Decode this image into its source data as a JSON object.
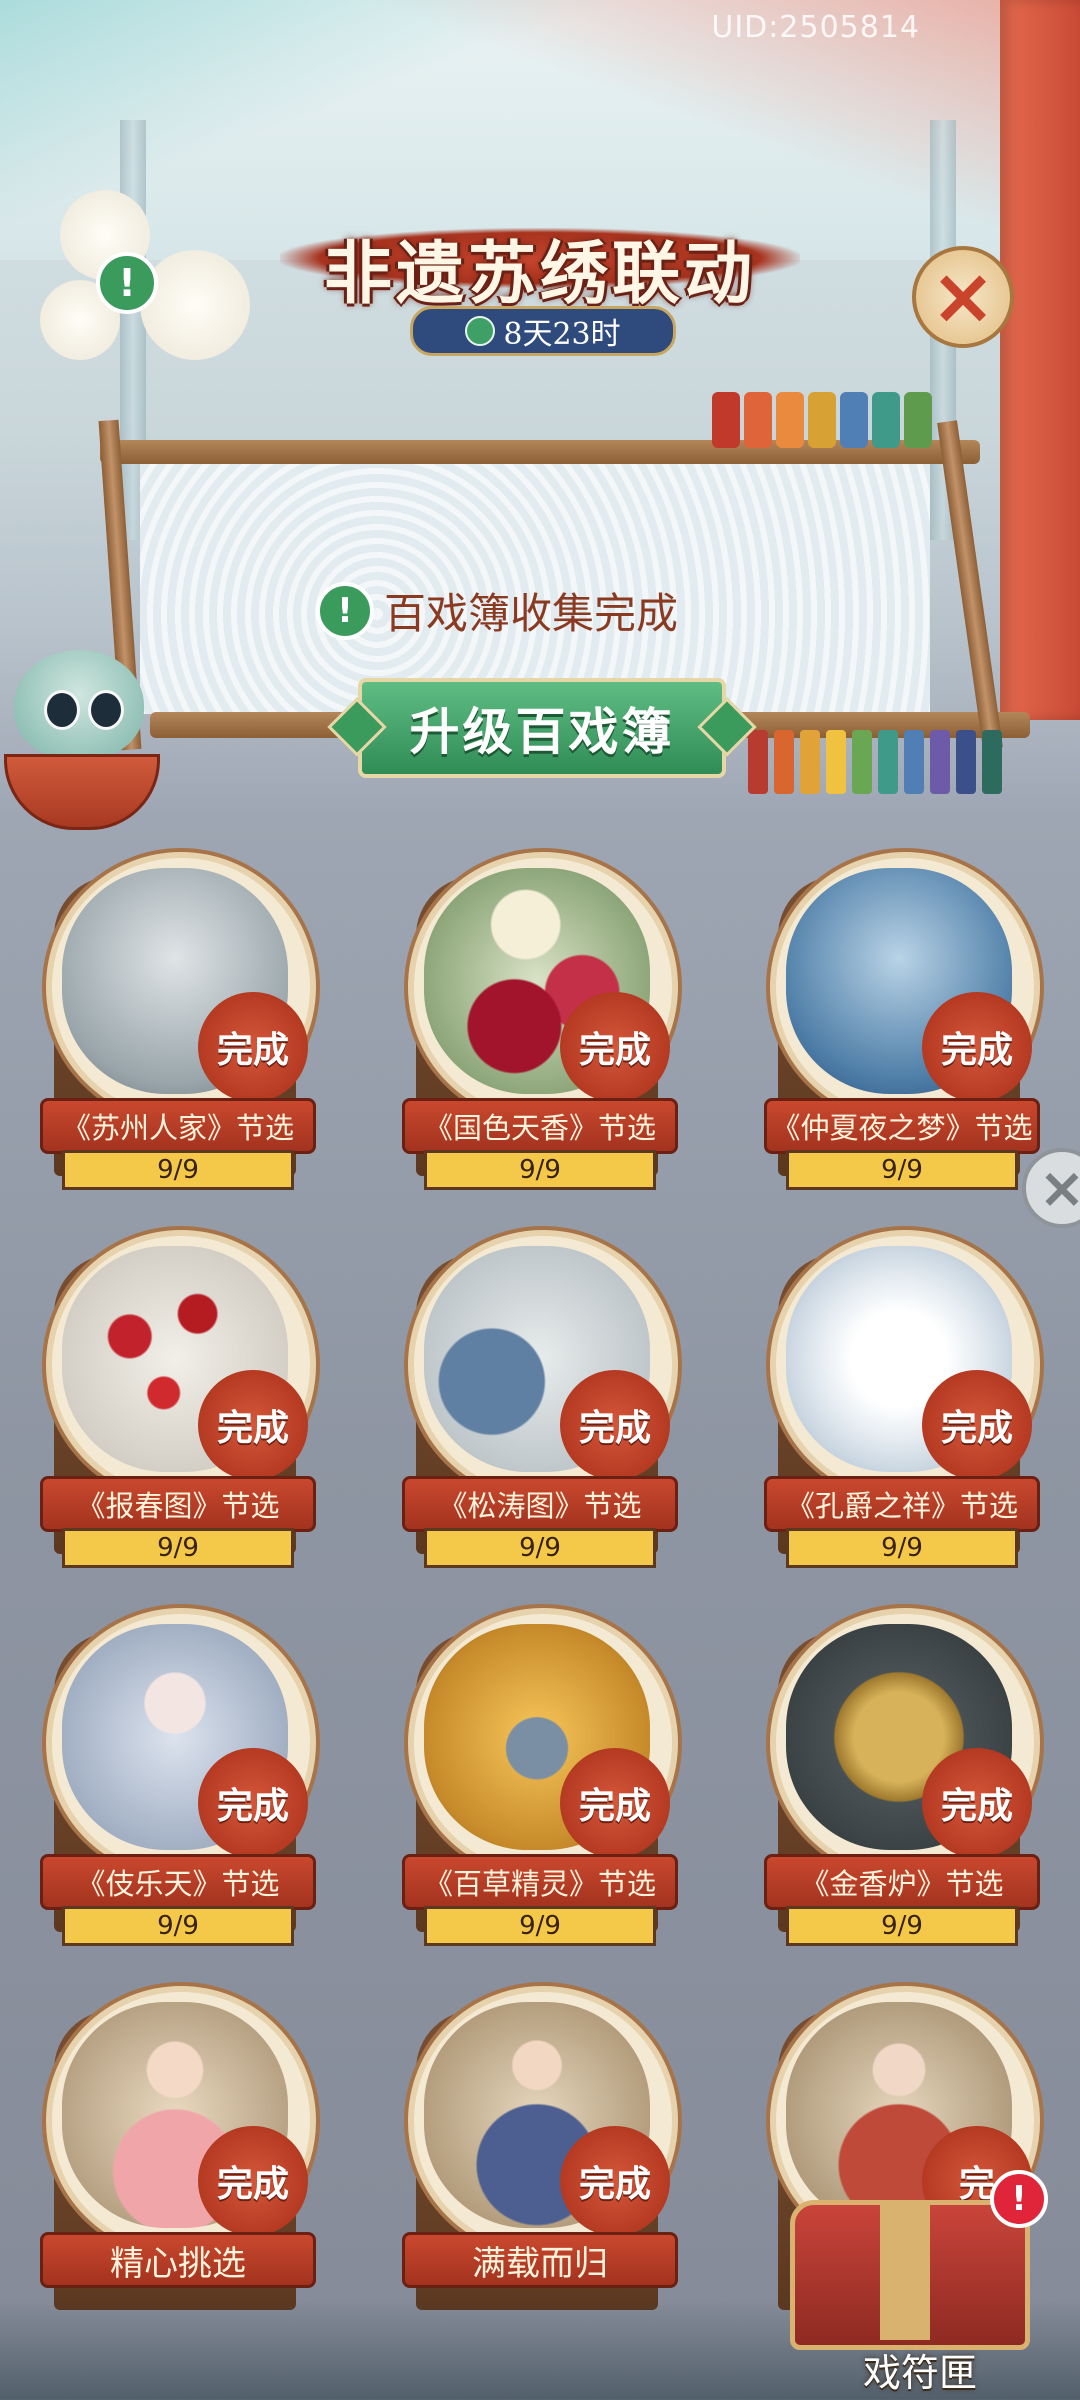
{
  "uid": "UID:2505814",
  "event": {
    "title": "非遗苏绣联动",
    "timer": "8天23时"
  },
  "status": {
    "collection_complete": "百戏簿收集完成",
    "upgrade_button": "升级百戏簿"
  },
  "cards": [
    {
      "label": "《苏州人家》节选",
      "progress": "9/9",
      "badge": "完成",
      "icon": "ink-village-art"
    },
    {
      "label": "《国色天香》节选",
      "progress": "9/9",
      "badge": "完成",
      "icon": "peony-art"
    },
    {
      "label": "《仲夏夜之梦》节选",
      "progress": "9/9",
      "badge": "完成",
      "icon": "lotus-night-art"
    },
    {
      "label": "《报春图》节选",
      "progress": "9/9",
      "badge": "完成",
      "icon": "plum-blossom-art"
    },
    {
      "label": "《松涛图》节选",
      "progress": "9/9",
      "badge": "完成",
      "icon": "pine-crane-art"
    },
    {
      "label": "《孔爵之祥》节选",
      "progress": "9/9",
      "badge": "完成",
      "icon": "white-peacock-art"
    },
    {
      "label": "《伎乐天》节选",
      "progress": "9/9",
      "badge": "完成",
      "icon": "celestial-musician-art"
    },
    {
      "label": "《百草精灵》节选",
      "progress": "9/9",
      "badge": "完成",
      "icon": "golden-monkey-art"
    },
    {
      "label": "《金香炉》节选",
      "progress": "9/9",
      "badge": "完成",
      "icon": "golden-censer-art"
    },
    {
      "label": "精心挑选",
      "badge": "完成",
      "icon": "lady-portrait-art"
    },
    {
      "label": "满载而归",
      "badge": "完成",
      "icon": "scholar-portrait-art"
    },
    {
      "badge": "完",
      "icon": "noble-lady-portrait-art"
    }
  ],
  "chest": {
    "label": "戏符匣",
    "badge": "!"
  },
  "icons": {
    "close": "×",
    "info": "!"
  },
  "colors": {
    "accent_red": "#c9482e",
    "progress_gold": "#f4c94a",
    "action_green": "#3a9b5c"
  }
}
